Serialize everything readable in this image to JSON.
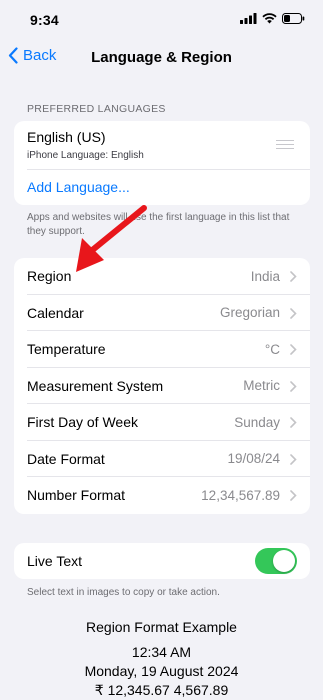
{
  "status": {
    "time": "9:34"
  },
  "nav": {
    "back_label": "Back",
    "title": "Language & Region"
  },
  "preferred_languages": {
    "header": "PREFERRED LANGUAGES",
    "primary": "English (US)",
    "secondary": "iPhone Language: English",
    "add_label": "Add Language...",
    "note": "Apps and websites will use the first language in this list that they support."
  },
  "settings": {
    "rows": [
      {
        "label": "Region",
        "value": "India"
      },
      {
        "label": "Calendar",
        "value": "Gregorian"
      },
      {
        "label": "Temperature",
        "value": "°C"
      },
      {
        "label": "Measurement System",
        "value": "Metric"
      },
      {
        "label": "First Day of Week",
        "value": "Sunday"
      },
      {
        "label": "Date Format",
        "value": "19/08/24"
      },
      {
        "label": "Number Format",
        "value": "12,34,567.89"
      }
    ]
  },
  "live_text": {
    "label": "Live Text",
    "enabled": true,
    "note": "Select text in images to copy or take action."
  },
  "example": {
    "title": "Region Format Example",
    "time": "12:34 AM",
    "date": "Monday, 19 August 2024",
    "numbers": "₹ 12,345.67   4,567.89"
  },
  "colors": {
    "accent": "#0a7aff",
    "toggle_on": "#34c759",
    "arrow": "#e8161b"
  }
}
